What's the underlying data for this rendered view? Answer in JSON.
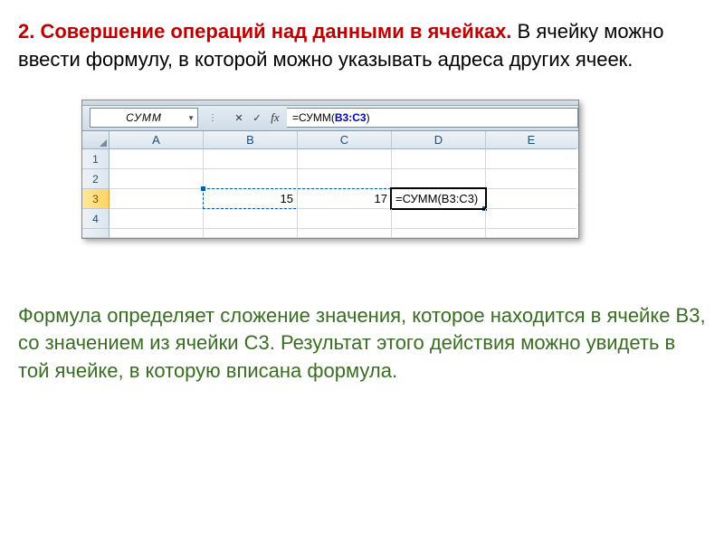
{
  "heading": {
    "red": "2. Совершение операций над данными в ячейках.",
    "black": " В ячейку можно ввести формулу, в которой можно указывать адреса других ячеек."
  },
  "excel": {
    "name_box": "СУММ",
    "fb_cancel": "✕",
    "fb_enter": "✓",
    "fb_fx": "fx",
    "formula_prefix": "=СУММ(",
    "formula_range": "B3:C3",
    "formula_suffix": ")",
    "col_labels": {
      "a": "A",
      "b": "B",
      "c": "C",
      "d": "D",
      "e": "E"
    },
    "row_labels": {
      "r1": "1",
      "r2": "2",
      "r3": "3",
      "r4": "4"
    },
    "b3": "15",
    "c3": "17",
    "d3": "=СУММ(B3:C3)"
  },
  "bottom": "Формула определяет сложение значения, которое находится в ячейке В3, со значением из ячейки С3. Результат этого действия можно увидеть в той ячейке, в которую вписана формула."
}
